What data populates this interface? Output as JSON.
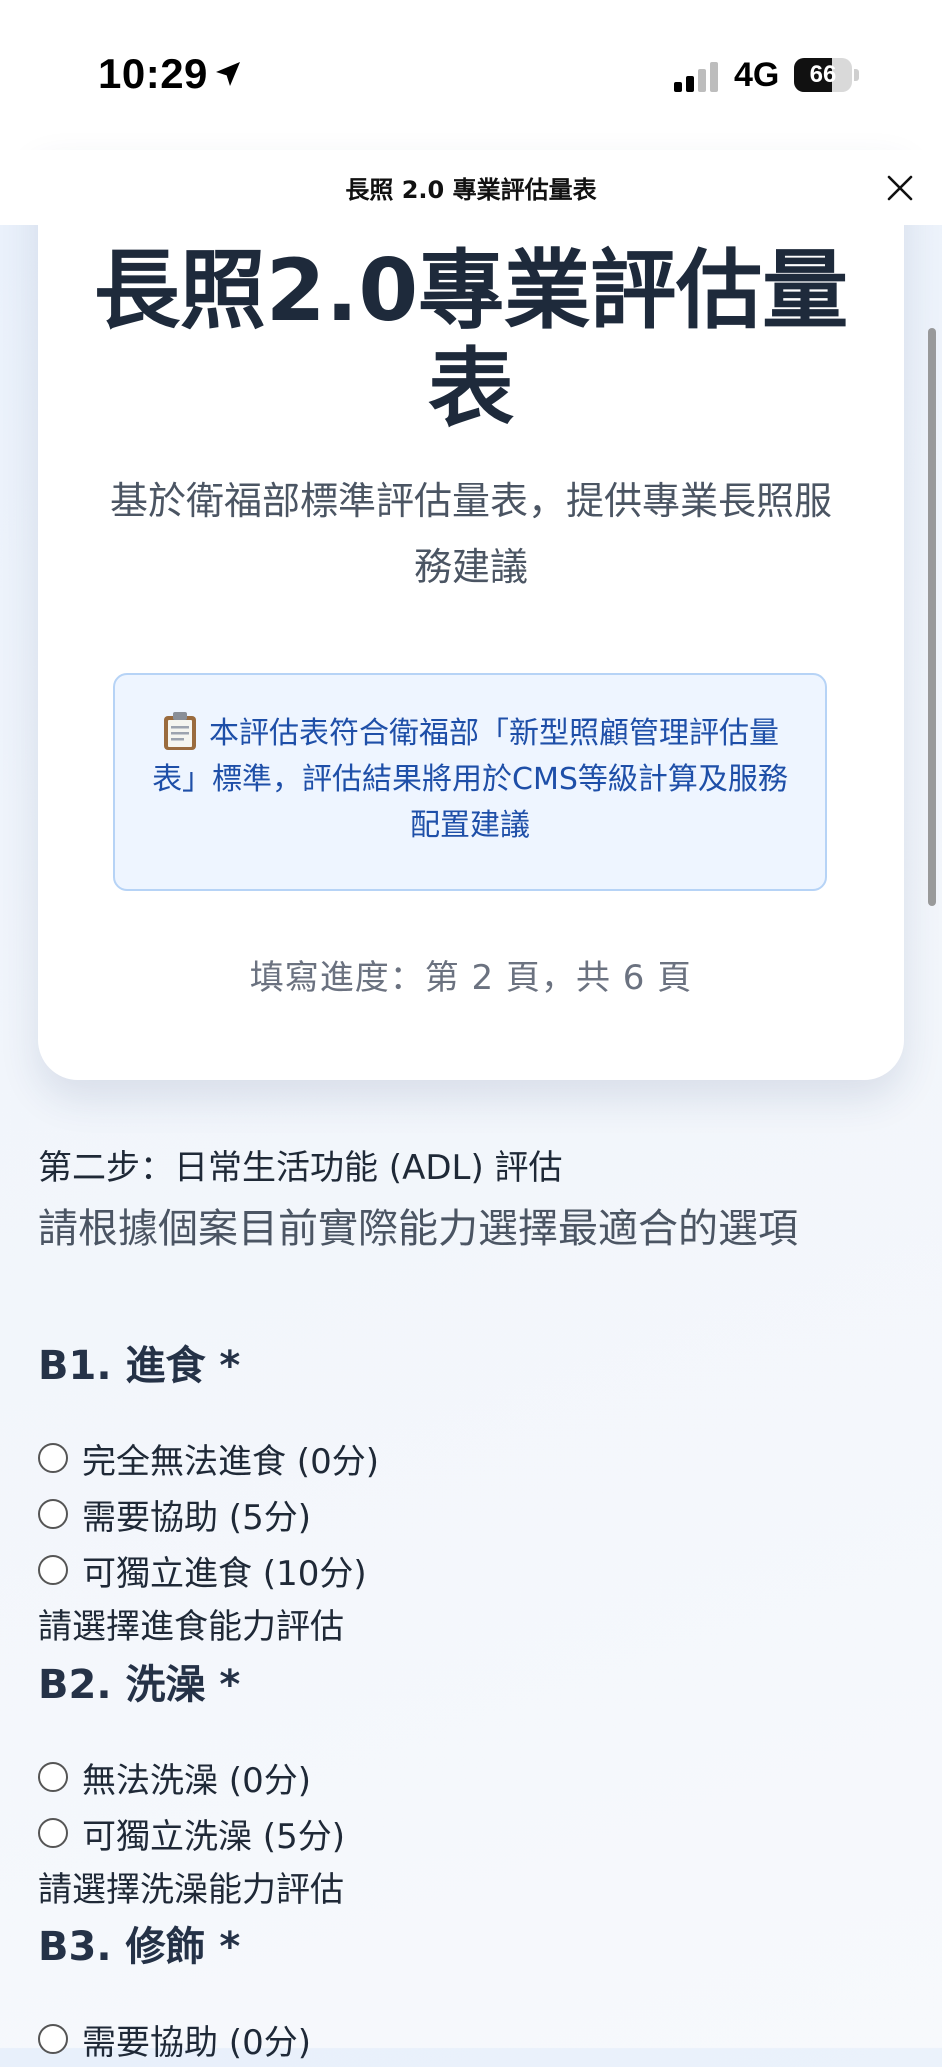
{
  "status_bar": {
    "time": "10:29",
    "network": "4G",
    "battery": "66",
    "battery_level": 0.66
  },
  "header": {
    "title": "長照 2.0 專業評估量表"
  },
  "hero": {
    "title": "長照2.0專業評估量表",
    "subtitle": "基於衛福部標準評估量表，提供專業長照服務建議",
    "info": "本評估表符合衛福部「新型照顧管理評估量表」標準，評估結果將用於CMS等級計算及服務配置建議",
    "progress": "填寫進度：第 2 頁，共 6 頁"
  },
  "form": {
    "step_title": "第二步：日常生活功能 (ADL) 評估",
    "step_desc": "請根據個案目前實際能力選擇最適合的選項",
    "questions": [
      {
        "label": "B1. 進食 *",
        "options": [
          "完全無法進食 (0分)",
          "需要協助 (5分)",
          "可獨立進食 (10分)"
        ],
        "hint": "請選擇進食能力評估"
      },
      {
        "label": "B2. 洗澡 *",
        "options": [
          "無法洗澡 (0分)",
          "可獨立洗澡 (5分)"
        ],
        "hint": "請選擇洗澡能力評估"
      },
      {
        "label": "B3. 修飾 *",
        "options": [
          "需要協助 (0分)"
        ]
      }
    ]
  }
}
